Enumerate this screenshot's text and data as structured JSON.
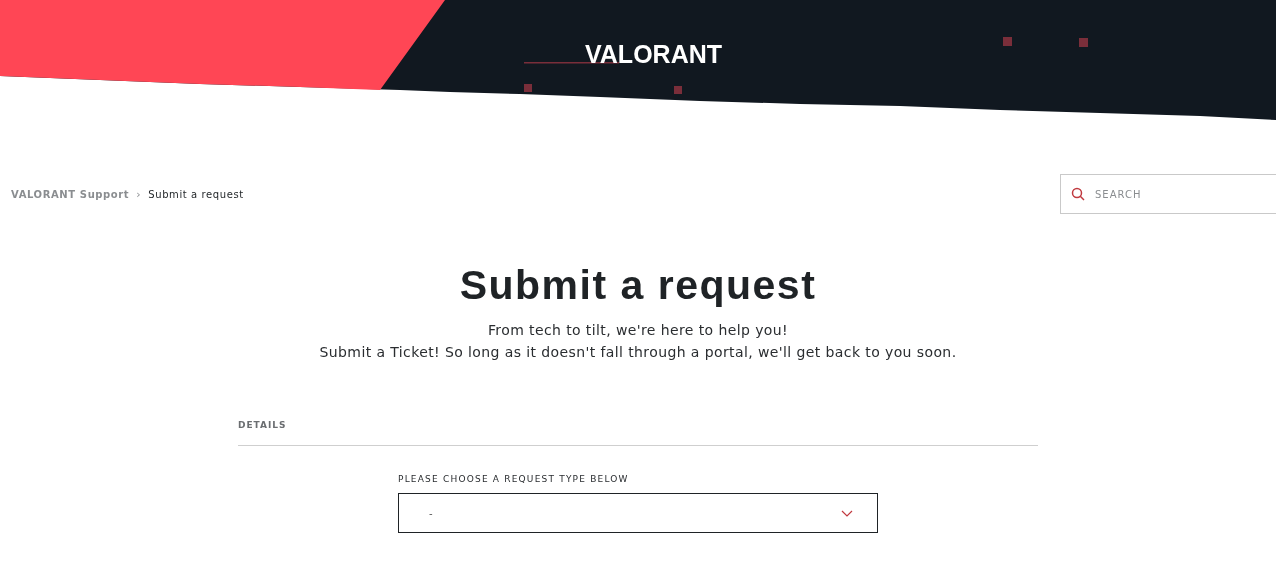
{
  "header": {
    "logo": "VALORANT"
  },
  "breadcrumb": [
    {
      "label": "VALORANT Support",
      "current": false
    },
    {
      "label": "Submit a request",
      "current": true
    }
  ],
  "breadcrumb_separator": "›",
  "search": {
    "placeholder": "SEARCH"
  },
  "page": {
    "title": "Submit a request",
    "subtitle_lines": [
      "From tech to tilt, we're here to help you!",
      "Submit a Ticket! So long as it doesn't fall through a portal, we'll get back to you soon."
    ]
  },
  "form": {
    "section": "DETAILS",
    "field_label": "PLEASE CHOOSE A REQUEST TYPE BELOW",
    "select_value": "-"
  }
}
